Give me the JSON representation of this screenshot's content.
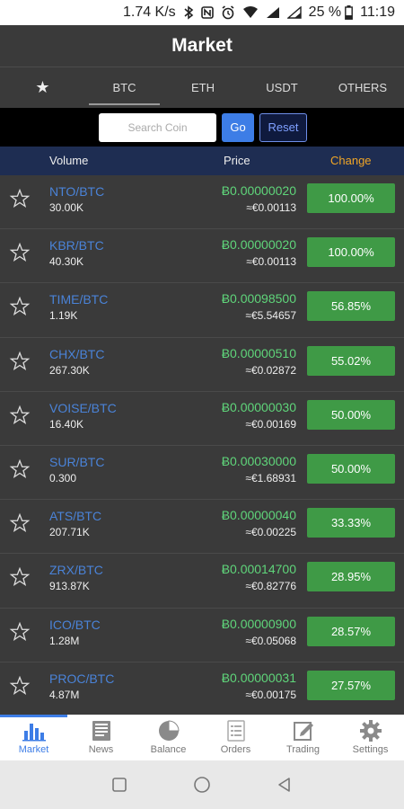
{
  "status_bar": {
    "speed": "1.74 K/s",
    "battery": "25 %",
    "time": "11:19"
  },
  "header": {
    "title": "Market"
  },
  "tabs": [
    {
      "label": "★",
      "icon": "star-icon",
      "active": false
    },
    {
      "label": "BTC",
      "active": true
    },
    {
      "label": "ETH",
      "active": false
    },
    {
      "label": "USDT",
      "active": false
    },
    {
      "label": "OTHERS",
      "active": false
    }
  ],
  "search": {
    "placeholder": "Search Coin",
    "value": "",
    "go_label": "Go",
    "reset_label": "Reset"
  },
  "columns": {
    "volume": "Volume",
    "price": "Price",
    "change": "Change"
  },
  "rows": [
    {
      "pair": "NTO/BTC",
      "volume": "30.00K",
      "price": "Ƀ0.00000020",
      "fiat": "≈€0.00113",
      "change": "100.00%"
    },
    {
      "pair": "KBR/BTC",
      "volume": "40.30K",
      "price": "Ƀ0.00000020",
      "fiat": "≈€0.00113",
      "change": "100.00%"
    },
    {
      "pair": "TIME/BTC",
      "volume": "1.19K",
      "price": "Ƀ0.00098500",
      "fiat": "≈€5.54657",
      "change": "56.85%"
    },
    {
      "pair": "CHX/BTC",
      "volume": "267.30K",
      "price": "Ƀ0.00000510",
      "fiat": "≈€0.02872",
      "change": "55.02%"
    },
    {
      "pair": "VOISE/BTC",
      "volume": "16.40K",
      "price": "Ƀ0.00000030",
      "fiat": "≈€0.00169",
      "change": "50.00%"
    },
    {
      "pair": "SUR/BTC",
      "volume": "0.300",
      "price": "Ƀ0.00030000",
      "fiat": "≈€1.68931",
      "change": "50.00%"
    },
    {
      "pair": "ATS/BTC",
      "volume": "207.71K",
      "price": "Ƀ0.00000040",
      "fiat": "≈€0.00225",
      "change": "33.33%"
    },
    {
      "pair": "ZRX/BTC",
      "volume": "913.87K",
      "price": "Ƀ0.00014700",
      "fiat": "≈€0.82776",
      "change": "28.95%"
    },
    {
      "pair": "ICO/BTC",
      "volume": "1.28M",
      "price": "Ƀ0.00000900",
      "fiat": "≈€0.05068",
      "change": "28.57%"
    },
    {
      "pair": "PROC/BTC",
      "volume": "4.87M",
      "price": "Ƀ0.00000031",
      "fiat": "≈€0.00175",
      "change": "27.57%"
    }
  ],
  "bottom_nav": [
    {
      "label": "Market",
      "icon": "bar-chart-icon",
      "active": true
    },
    {
      "label": "News",
      "icon": "newspaper-icon",
      "active": false
    },
    {
      "label": "Balance",
      "icon": "pie-chart-icon",
      "active": false
    },
    {
      "label": "Orders",
      "icon": "list-icon",
      "active": false
    },
    {
      "label": "Trading",
      "icon": "edit-icon",
      "active": false
    },
    {
      "label": "Settings",
      "icon": "gear-icon",
      "active": false
    }
  ],
  "colors": {
    "accent_blue": "#3d7de6",
    "change_green": "#3f9a46",
    "price_green": "#5fd57a",
    "change_header_orange": "#f0a526",
    "pair_blue": "#4a83d8"
  }
}
